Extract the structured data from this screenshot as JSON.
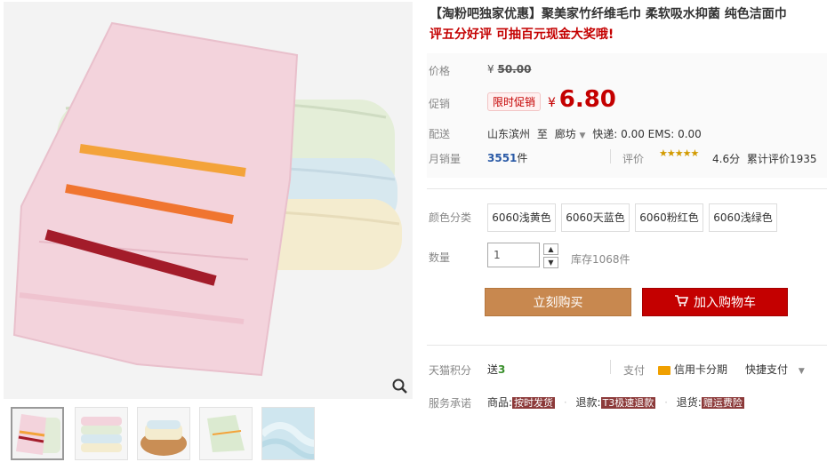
{
  "product": {
    "title": "【淘粉吧独家优惠】聚美家竹纤维毛巾 柔软吸水抑菌 纯色洁面巾",
    "promo": "评五分好评 可抽百元现金大奖哦!"
  },
  "price": {
    "label": "价格",
    "currency": "¥",
    "original": "50.00",
    "promo_label": "促销",
    "promo_badge": "限时促销",
    "current": "6.80"
  },
  "shipping": {
    "label": "配送",
    "from": "山东滨州",
    "to_word": "至",
    "to": "廊坊",
    "fees": "快递: 0.00 EMS: 0.00"
  },
  "sales": {
    "label": "月销量",
    "count": "3551",
    "unit": "件",
    "rating_label": "评价",
    "rating": "4.6分",
    "reviews_label": "累计评价",
    "reviews": "1935"
  },
  "sku": {
    "label": "颜色分类",
    "options": [
      "6060浅黄色",
      "6060天蓝色",
      "6060粉红色",
      "6060浅绿色"
    ]
  },
  "quantity": {
    "label": "数量",
    "value": "1",
    "stock": "库存1068件"
  },
  "actions": {
    "buy": "立刻购买",
    "cart": "加入购物车"
  },
  "points": {
    "label": "天猫积分",
    "send": "送",
    "amount": "3",
    "pay_label": "支付",
    "credit": "信用卡分期",
    "quick": "快捷支付"
  },
  "service": {
    "label": "服务承诺",
    "goods": "商品:",
    "goods_tag": "按时发货",
    "refund": "退款:",
    "refund_tag": "T3极速退款",
    "return": "退货:",
    "return_tag": "赠运费险"
  },
  "icons": {
    "zoom": "magnifier-icon",
    "cart": "cart-icon",
    "card": "credit-card-icon",
    "stars": "rating-stars-icon"
  },
  "colors": {
    "accent": "#c40000",
    "buy_button": "#c8884f",
    "cart_button": "#c40000",
    "link_blue": "#2a5aa6"
  }
}
